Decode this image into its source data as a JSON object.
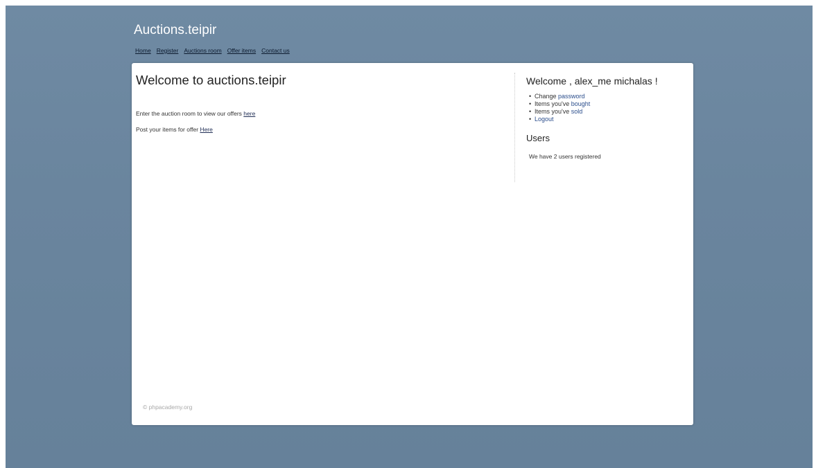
{
  "site": {
    "title": "Auctions.teipir"
  },
  "nav": {
    "home": "Home",
    "register": "Register",
    "auctions_room": "Auctions room",
    "offer_items": "Offer items",
    "contact_us": "Contact us"
  },
  "main": {
    "heading": "Welcome to auctions.teipir",
    "line1_text": "Enter the auction room to view our offers ",
    "line1_link": "here",
    "line2_text": "Post your items for offer ",
    "line2_link": "Here"
  },
  "sidebar": {
    "welcome": "Welcome , alex_me michalas !",
    "items": [
      {
        "prefix": "Change ",
        "link": "password"
      },
      {
        "prefix": "Items you've ",
        "link": "bought"
      },
      {
        "prefix": "Items you've ",
        "link": "sold"
      },
      {
        "prefix": "",
        "link": "Logout"
      }
    ],
    "users_heading": "Users",
    "users_text": "We have 2 users registered"
  },
  "footer": {
    "text": "© phpacademy.org"
  },
  "colors": {
    "background": "#6f8aa3",
    "card": "#ffffff",
    "link": "#2b4e8c"
  }
}
